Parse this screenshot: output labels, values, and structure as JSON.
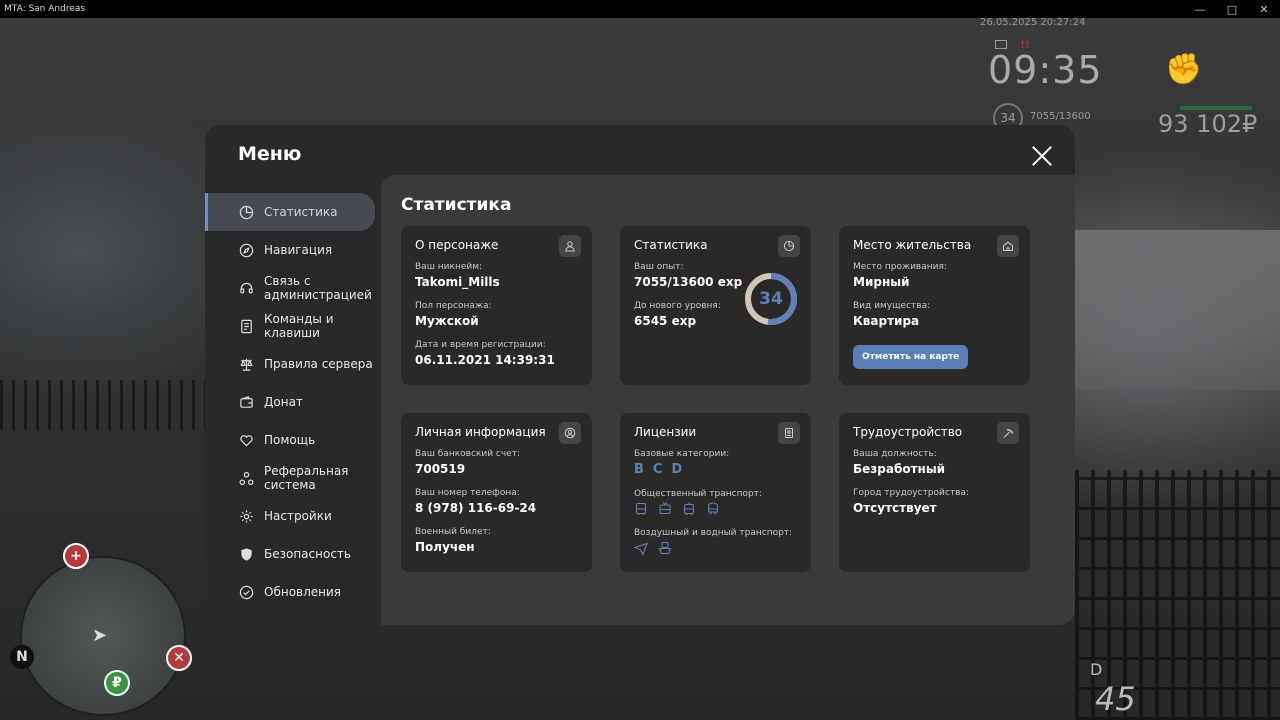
{
  "window": {
    "title": "MTA: San Andreas",
    "controls": [
      "—",
      "□",
      "✕"
    ]
  },
  "hud": {
    "date": "26.05.2025 20:27:24",
    "time": "09:35",
    "level": "34",
    "exp": "7055/13600",
    "money": "93 102₽",
    "alert": "!!",
    "minimap_north": "N",
    "gear": "D",
    "speed": "45"
  },
  "menu": {
    "title": "Меню",
    "sidebar": [
      {
        "label": "Статистика",
        "icon": "pie-chart-icon",
        "active": true
      },
      {
        "label": "Навигация",
        "icon": "compass-icon"
      },
      {
        "label": "Связь с администрацией",
        "icon": "headset-icon"
      },
      {
        "label": "Команды и клавиши",
        "icon": "document-icon"
      },
      {
        "label": "Правила сервера",
        "icon": "scales-icon"
      },
      {
        "label": "Донат",
        "icon": "wallet-icon"
      },
      {
        "label": "Помощь",
        "icon": "heart-hand-icon"
      },
      {
        "label": "Реферальная система",
        "icon": "referral-icon"
      },
      {
        "label": "Настройки",
        "icon": "gear-icon"
      },
      {
        "label": "Безопасность",
        "icon": "shield-icon"
      },
      {
        "label": "Обновления",
        "icon": "check-circle-icon"
      }
    ],
    "content_title": "Статистика",
    "cards": {
      "character": {
        "title": "О персонаже",
        "icon": "user-icon",
        "nickname_label": "Ваш никнейм:",
        "nickname": "Takomi_Mills",
        "gender_label": "Пол персонажа:",
        "gender": "Мужской",
        "reg_label": "Дата и время регистрации:",
        "reg": "06.11.2021 14:39:31"
      },
      "stats": {
        "title": "Статистика",
        "icon": "clock-pie-icon",
        "exp_label": "Ваш опыт:",
        "exp": "7055/13600 exp",
        "next_label": "До нового уровня:",
        "next": "6545 exp",
        "level": "34",
        "progress": 0.52
      },
      "residence": {
        "title": "Место жительства",
        "icon": "home-icon",
        "place_label": "Место проживания:",
        "place": "Мирный",
        "type_label": "Вид имущества:",
        "type": "Квартира",
        "button": "Отметить на карте"
      },
      "personal": {
        "title": "Личная информация",
        "icon": "user-circle-icon",
        "bank_label": "Ваш банковский счет:",
        "bank": "700519",
        "phone_label": "Ваш номер телефона:",
        "phone": "8 (978) 116-69-24",
        "military_label": "Военный билет:",
        "military": "Получен"
      },
      "licenses": {
        "title": "Лицензии",
        "icon": "license-icon",
        "base_label": "Базовые категории:",
        "categories": [
          "B",
          "C",
          "D"
        ],
        "public_label": "Общественный транспорт:",
        "air_label": "Воздушный и водный транспорт:"
      },
      "employment": {
        "title": "Трудоустройство",
        "icon": "pickaxe-icon",
        "position_label": "Ваша должность:",
        "position": "Безработный",
        "city_label": "Город трудоустройства:",
        "city": "Отсутствует"
      }
    }
  },
  "colors": {
    "accent": "#5f80b8",
    "menu_bg": "#29292a",
    "content_bg": "#3b3a39",
    "card_bg": "#2a2928"
  }
}
